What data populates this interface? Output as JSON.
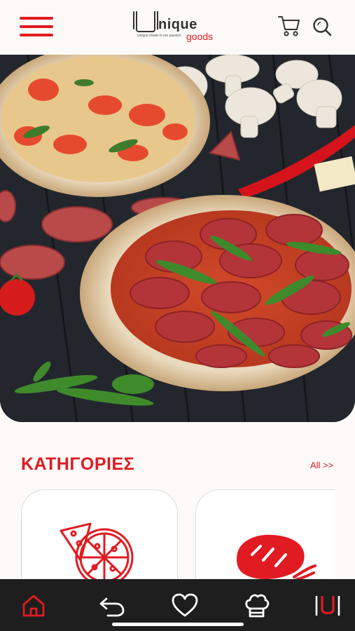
{
  "header": {
    "menu_icon": "hamburger-menu-icon",
    "logo": {
      "letter": "U",
      "wordmark": "nique",
      "subword": "goods",
      "tagline": "Unique meals is our passion"
    },
    "cart_icon": "shopping-cart-icon",
    "search_icon": "search-icon"
  },
  "hero": {
    "image": "pepperoni-pizza-photo"
  },
  "categories": {
    "title": "ΚΑΤΗΓΟΡΙΕΣ",
    "all_link": "All >>",
    "items": [
      {
        "icon": "pizza-icon"
      },
      {
        "icon": "bread-icon"
      }
    ]
  },
  "bottom_nav": {
    "items": [
      {
        "icon": "home-icon",
        "active": true
      },
      {
        "icon": "back-arrow-icon",
        "active": false
      },
      {
        "icon": "heart-icon",
        "active": false
      },
      {
        "icon": "chef-hat-icon",
        "active": false
      },
      {
        "icon": "brand-logo-icon",
        "active": false
      }
    ]
  },
  "colors": {
    "accent": "#e11b22",
    "background": "#fbfaf8",
    "nav_background": "#1e1e1e",
    "card_border": "#d9d9d9"
  }
}
